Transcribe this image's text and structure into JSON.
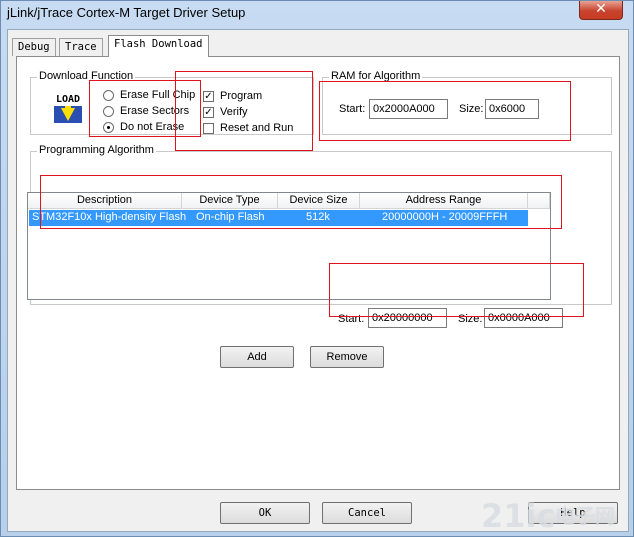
{
  "window": {
    "title": "jLink/jTrace Cortex-M Target Driver Setup",
    "close_glyph": "✕"
  },
  "tabs": [
    {
      "label": "Debug"
    },
    {
      "label": "Trace"
    },
    {
      "label": "Flash Download"
    }
  ],
  "download_function": {
    "title": "Download Function",
    "icon": "load-icon",
    "icon_text": "LOAD",
    "radios": [
      {
        "label": "Erase Full Chip",
        "selected": false
      },
      {
        "label": "Erase Sectors",
        "selected": false
      },
      {
        "label": "Do not Erase",
        "selected": true
      }
    ],
    "checks": [
      {
        "label": "Program",
        "checked": true
      },
      {
        "label": "Verify",
        "checked": true
      },
      {
        "label": "Reset and Run",
        "checked": false
      }
    ]
  },
  "ram": {
    "title": "RAM for Algorithm",
    "start_label": "Start:",
    "start_value": "0x2000A000",
    "size_label": "Size:",
    "size_value": "0x6000"
  },
  "programming": {
    "title": "Programming Algorithm",
    "columns": [
      "Description",
      "Device Type",
      "Device Size",
      "Address Range"
    ],
    "rows": [
      {
        "description": "STM32F10x High-density Flash",
        "device_type": "On-chip Flash",
        "device_size": "512k",
        "address_range": "20000000H - 20009FFFH"
      }
    ],
    "start_label": "Start:",
    "start_value": "0x20000000",
    "size_label": "Size:",
    "size_value": "0x0000A000",
    "add_label": "Add",
    "remove_label": "Remove"
  },
  "footer": {
    "ok_label": "OK",
    "cancel_label": "Cancel",
    "help_label": "Help"
  },
  "watermark": {
    "text_left": "21ic",
    "text_right": "电子网"
  },
  "colors": {
    "selection": "#3399ff",
    "annotation": "#e0141e"
  }
}
